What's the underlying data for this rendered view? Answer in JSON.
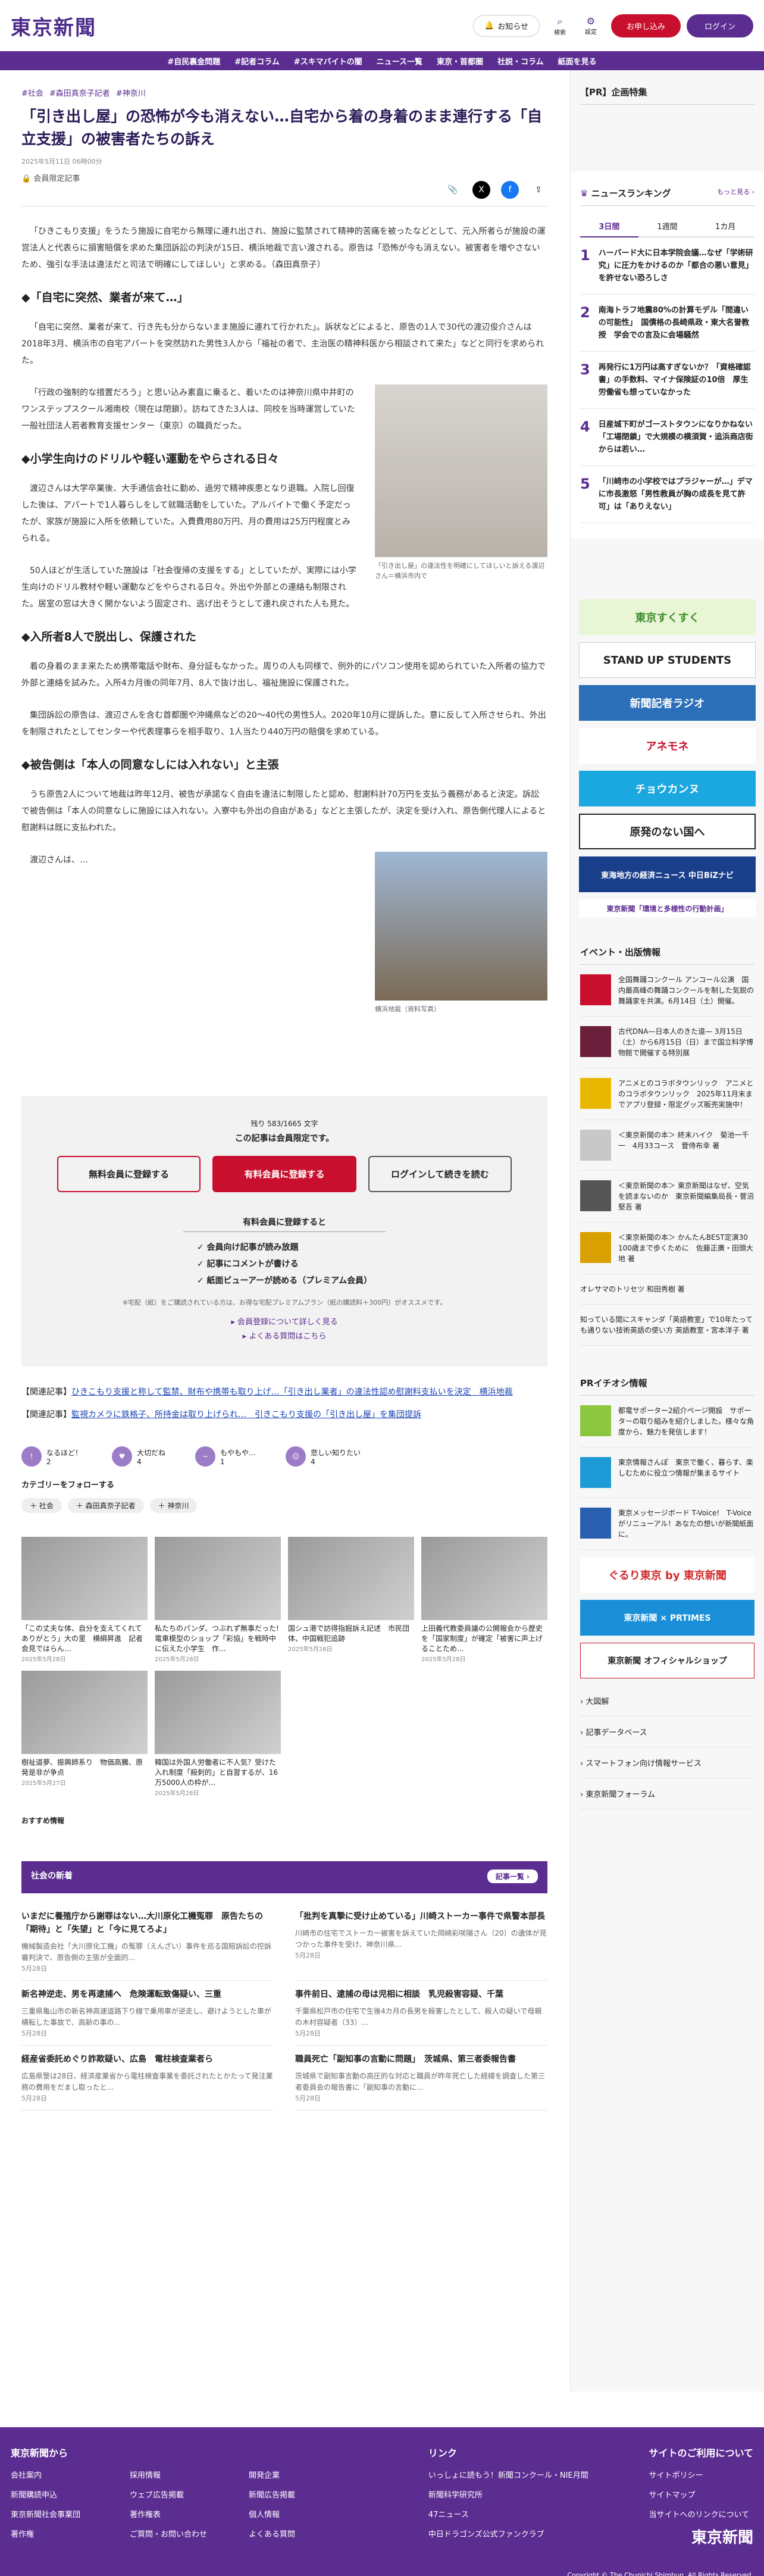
{
  "header": {
    "logo": "東京新聞",
    "notif": "お知らせ",
    "search": "検索",
    "settings": "設定",
    "register": "お申し込み",
    "login": "ログイン"
  },
  "nav": [
    "#自民裏金問題",
    "#記者コラム",
    "#スキマバイトの闇",
    "ニュース一覧",
    "東京・首都圏",
    "社説・コラム",
    "紙面を見る"
  ],
  "article": {
    "tags": [
      "#社会",
      "#森田真奈子記者",
      "#神奈川"
    ],
    "title": "「引き出し屋」の恐怖が今も消えない…自宅から着の身着のまま連行する「自立支援」の被害者たちの訴え",
    "date": "2025年5月11日 06時00分",
    "member": "会員限定記事",
    "p1": "「ひきこもり支援」をうたう施設に自宅から無理に連れ出され、施設に監禁されて精神的苦痛を被ったなどとして、元入所者らが施設の運営法人と代表らに損害賠償を求めた集団訴訟の判決が15日、横浜地裁で言い渡される。原告は「恐怖が今も消えない。被害者を増やさないため、強引な手法は違法だと司法で明確にしてほしい」と求める。（森田真奈子）",
    "h1": "◆「自宅に突然、業者が来て…」",
    "p2": "「自宅に突然、業者が来て、行き先も分からないまま施設に連れて行かれた」。訴状などによると、原告の1人で30代の渡辺俊介さんは2018年3月、横浜市の自宅アパートを突然訪れた男性3人から「福祉の者で、主治医の精神科医から相談されて来た」などと同行を求められた。",
    "p3": "「行政の強制的な措置だろう」と思い込み素直に乗ると、着いたのは神奈川県中井町のワンステップスクール湘南校（現在は閉鎖）。訪ねてきた3人は、同校を当時運営していた一般社団法人若者教育支援センター（東京）の職員だった。",
    "fig_caption": "「引き出し屋」の違法性を明確にしてほしいと訴える渡辺さん＝横浜市内で",
    "h2": "◆小学生向けのドリルや軽い運動をやらされる日々",
    "p4": "渡辺さんは大学卒業後、大手通信会社に勤め、過労で精神疾患となり退職。入院し回復した後は、アパートで1人暮らしをして就職活動をしていた。アルバイトで働く予定だったが、家族が施設に入所を依頼していた。入費費用80万円、月の費用は25万円程度とみられる。",
    "p5": "50人ほどが生活していた施設は「社会復帰の支援をする」としていたが、実際には小学生向けのドリル教材や軽い運動などをやらされる日々。外出や外部との連絡も制限された。居室の窓は大きく開かないよう固定され、逃げ出そうとして連れ戻された人も見た。",
    "h3": "◆入所者8人で脱出し、保護された",
    "p6": "着の身着のまま来たため携帯電話や財布、身分証もなかった。周りの人も同様で、例外的にパソコン使用を認められていた入所者の協力で外部と連絡を試みた。入所4カ月後の同年7月、8人で抜け出し、福祉施設に保護された。",
    "p7": "集団訴訟の原告は、渡辺さんを含む首都圏や沖縄県などの20～40代の男性5人。2020年10月に提訴した。意に反して入所させられ、外出を制限されたとしてセンターや代表理事らを相手取り、1人当たり440万円の賠償を求めている。",
    "h4": "◆被告側は「本人の同意なしには入れない」と主張",
    "p8": "うち原告2人について地裁は昨年12月、被告が承諾なく自由を違法に制限したと認め、慰謝料計70万円を支払う義務があると決定。訴訟で被告側は「本人の同意なしに施設には入れない。入寮中も外出の自由がある」などと主張したが、決定を受け入れ、原告側代理人によると慰謝料は既に支払われた。",
    "p9": "渡辺さんは、…",
    "fig2_caption": "横浜地裁（資料写真）"
  },
  "paywall": {
    "remain": "残り 583/1665 文字",
    "notice": "この記事は会員限定です。",
    "free": "無料会員に登録する",
    "paid": "有料会員に登録する",
    "login": "ログインして続きを読む",
    "benefits_title": "有料会員に登録すると",
    "benefits": [
      "✓ 会員向け記事が読み放題",
      "✓ 記事にコメントが書ける",
      "✓ 紙面ビューアーが読める（プレミアム会員）"
    ],
    "note": "※宅配（紙）をご購読されている方は、お得な宅配プレミアムプラン（紙の購読料＋300円）がオススメです。",
    "more1": "▸ 会員登録について詳しく見る",
    "more2": "▸ よくある質問はこちら"
  },
  "related": [
    {
      "label": "【関連記事】",
      "text": "ひきこもり支援と称して監禁、財布や携帯も取り上げ…「引き出し業者」の違法性認め慰謝料支払いを決定　横浜地裁"
    },
    {
      "label": "【関連記事】",
      "text": "監視カメラに鉄格子、所持金は取り上げられ…　引きこもり支援の「引き出し屋」を集団提訴"
    }
  ],
  "reactions": [
    {
      "label": "なるほど！",
      "count": "2"
    },
    {
      "label": "大切だね",
      "count": "4"
    },
    {
      "label": "もやもや…",
      "count": "1"
    },
    {
      "label": "悲しい知りたい",
      "count": "4"
    }
  ],
  "follow": "カテゴリーをフォローする",
  "chips": [
    "＋ 社会",
    "＋ 森田真奈子記者",
    "＋ 神奈川"
  ],
  "thumbs": [
    {
      "t": "「この丈夫な体、自分を支えてくれてありがとう」大の里　横綱昇進　記者会見ではらん…",
      "d": "2025年5月28日"
    },
    {
      "t": "私たちのパンダ、つぶれず無事だった!　電車模型のショップ「彩協」を戦時中に伝えた小学生　作...",
      "d": "2025年5月28日"
    },
    {
      "t": "国シュ港で訪得指掘訴え記述　市民団体、中国戦犯追跡",
      "d": "2025年5月28日"
    },
    {
      "t": "上田義代教委員議の公開報会から歴史を「国家制度」が確定「被害に声上げることため...",
      "d": "2025年5月28日"
    },
    {
      "t": "樹祉道夢、振興師系り　物価高騰、原発是非が争点",
      "d": "2025年5月27日"
    },
    {
      "t": "韓国は外国人労働者に不人気？受けた入れ制度「殺刺的」と自習するが、16万5000人の枠が...",
      "d": "2025年5月28日"
    }
  ],
  "osusume": "おすすめ情報",
  "news": {
    "title": "社会の新着",
    "more": "記事一覧 ›",
    "items": [
      {
        "h": "いまだに養殖庁から謝罪はない…大川原化工機冤罪　原告たちの「期待」と「失望」と「今に見てろよ」",
        "p": "機械製造会社「大川原化工機」の冤罪（えんざい）事件を巡る国賠訴訟の控訴審判決で、原告側の主張が全面的...",
        "d": "5月28日"
      },
      {
        "h": "「批判を真摯に受け止めている」川崎ストーカー事件で県警本部長",
        "p": "川崎市の住宅でストーカー被害を訴えていた岡崎彩咲陽さん（20）の遺体が見つかった事件を受け、神奈川県...",
        "d": "5月28日"
      },
      {
        "h": "新名神逆走、男を再逮捕へ　危険運転致傷疑い、三重",
        "p": "三重県亀山市の新名神高速道路下り線で乗用車が逆走し、避けようとした車が横転した事故で、高齢の事の...",
        "d": "5月28日"
      },
      {
        "h": "事件前日、逮捕の母は児相に相談　乳児殺害容疑、千葉",
        "p": "千葉県松戸市の住宅で生後4カ月の長男を殺害したとして、殺人の疑いで母親の木村容疑者（33）...",
        "d": "5月28日"
      },
      {
        "h": "経産省委託めぐり詐欺疑い、広島　電柱検査業者ら",
        "p": "広島県警は28日、経済産業省から電柱検査事業を委託されたとかたって発注業務の費用をだまし取ったと...",
        "d": "5月28日"
      },
      {
        "h": "職員死亡「副知事の言動に問題」　茨城県、第三者委報告書",
        "p": "茨城県で副知事言動の高圧的な対応と職員が昨年死亡した経緯を調査した第三者委員会の報告書に「副知事の言動に...",
        "d": "5月28日"
      }
    ]
  },
  "side": {
    "pr": "【PR】企画特集",
    "ranking_title": "ニュースランキング",
    "ranking_more": "もっと見る ›",
    "tabs": [
      "3日間",
      "1週間",
      "1カ月"
    ],
    "ranks": [
      "ハーバード大に日本学院会議…なぜ「学術研究」に圧力をかけるのか「都合の悪い意見」を許せない恐ろしさ",
      "南海トラフ地震80%の計算モデル「間違いの可能性」　国債格の長崎県政・東大名誉教授　学会での言及に会場騒然",
      "再発行に1万円は高すぎないか？「資格確認書」の手数料、マイナ保険証の10倍　厚生労働省も想っていなかった",
      "日産城下町がゴーストタウンになりかねない「工場閉鎖」で大規模の横須賀・追浜商店街からは若い…",
      "「川崎市の小学校ではプラジャーが…」デマに市長激怒「男性教員が胸の成長を見て許可」は「ありえない」"
    ],
    "banners": [
      "東京すくすく",
      "STAND UP STUDENTS",
      "新聞記者ラジオ",
      "アネモネ",
      "チョウカンヌ",
      "原発のない国へ",
      "東海地方の経済ニュース 中日BiZナビ",
      "東京新聞「環境と多様性の行動計画」"
    ],
    "event_title": "イベント・出版情報",
    "events": [
      "全国舞踊コンクール アンコール公演　国内最高峰の舞踊コンクールを制した気鋭の舞踊家を共演。6月14日（土）開催。",
      "古代DNA—日本人のきた道— 3月15日（土）から6月15日（日）まで国立科学博物館で開催する特別展",
      "アニメとのコラボタウンリック　アニメとのコラボタウンリック　2025年11月末までアプリ登録・限定グッズ販売実施中！",
      "＜東京新聞の本＞ 終末ハイク　菊池一千一　4月33コース　菅侍布幸 著",
      "＜東京新聞の本＞ 東京新聞はなぜ、空気を読まないのか　東京新聞編集局長・菅沼堅吾 著",
      "＜東京新聞の本＞ かんたんBEST定演30　100歳まで歩くために　佐藤正廣・田頭大地 著"
    ],
    "event_links": [
      "オレサマのトリセツ 和田秀樹 著",
      "知っている間にスキャンダ「英語教室」で10年たっても通りない技術英語の使い方 英語教室・宮本洋子 著"
    ],
    "pr_info": "PRイチオシ情報",
    "pr_items": [
      "都電サポーター2紹介ページ開設　サポーターの取り組みを紹介しました。様々な角度から、魅力を発信します！",
      "東京情報さんぽ　東京で働く、暮らす、楽しむために役立つ情報が集まるサイト",
      "東京メッセージボード T-Voice!　T-Voiceがリニューアル！あなたの想いが新聞紙面に。"
    ],
    "pr_banners": [
      "ぐるり東京 by 東京新聞",
      "東京新聞 × PRTIMES",
      "東京新聞 オフィシャルショップ"
    ],
    "links": [
      "› 大図解",
      "› 記事データベース",
      "› スマートフォン向け情報サービス",
      "› 東京新聞フォーラム"
    ]
  },
  "footer": {
    "col1": "東京新聞から",
    "col1_items": [
      "会社案内",
      "採用情報",
      "開発企業",
      "新聞購読申込",
      "ウェブ広告掲載",
      "新聞広告掲載",
      "東京新聞社会事業団",
      "著作権表",
      "個人情報",
      "著作権",
      "ご質問・お問い合わせ",
      "よくある質問"
    ],
    "col2": "リンク",
    "col2_items": [
      "いっしょに読もう！新聞コンクール・NIE月間",
      "新聞科学研究所",
      "47ニュース",
      "中日ドラゴンズ公式ファンクラブ"
    ],
    "col3": "サイトのご利用について",
    "col3_items": [
      "サイトポリシー",
      "サイトマップ",
      "当サイトへのリンクについて"
    ],
    "logo": "東京新聞",
    "copyright": "Copyright © The Chunichi Shimbun, All Rights Reserved."
  },
  "colors": {
    "brand": "#5c2d91",
    "red": "#c8102e"
  }
}
